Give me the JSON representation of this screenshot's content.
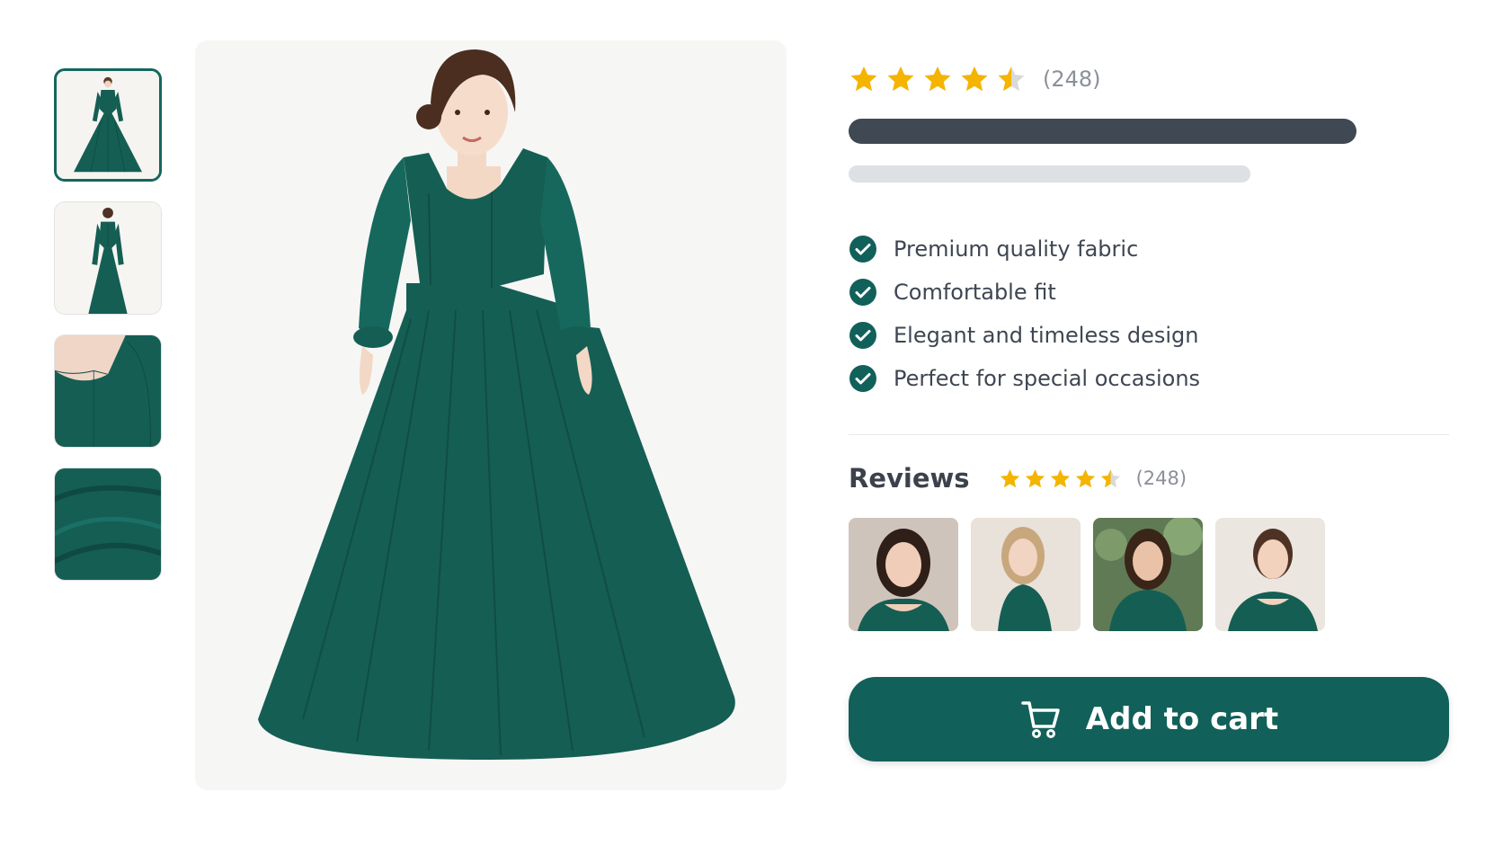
{
  "product": {
    "rating": {
      "value": 4.5,
      "max": 5,
      "count_label": "(248)"
    },
    "title_placeholder": "",
    "subtitle_placeholder": "",
    "features": [
      {
        "icon": "check-circle-icon",
        "label": "Premium quality fabric"
      },
      {
        "icon": "check-circle-icon",
        "label": "Comfortable fit"
      },
      {
        "icon": "check-circle-icon",
        "label": "Elegant and timeless design"
      },
      {
        "icon": "check-circle-icon",
        "label": "Perfect for special occasions"
      }
    ],
    "thumbnails": [
      {
        "subject": "dress-front-full",
        "selected": true
      },
      {
        "subject": "dress-back-full",
        "selected": false
      },
      {
        "subject": "dress-neckline-detail",
        "selected": false
      },
      {
        "subject": "fabric-detail",
        "selected": false
      }
    ]
  },
  "reviews": {
    "title": "Reviews",
    "rating_value": 4.5,
    "count_label": "(248)",
    "photos": [
      {
        "subject": "customer-photo-1"
      },
      {
        "subject": "customer-photo-2"
      },
      {
        "subject": "customer-photo-3"
      },
      {
        "subject": "customer-photo-4"
      }
    ]
  },
  "actions": {
    "add_to_cart_label": "Add to cart",
    "add_to_cart_icon": "shopping-cart-icon"
  },
  "colors": {
    "brand_green": "#12605a",
    "dress_green": "#155e54",
    "star_gold": "#f4b400",
    "star_empty": "#d9d9d9"
  }
}
